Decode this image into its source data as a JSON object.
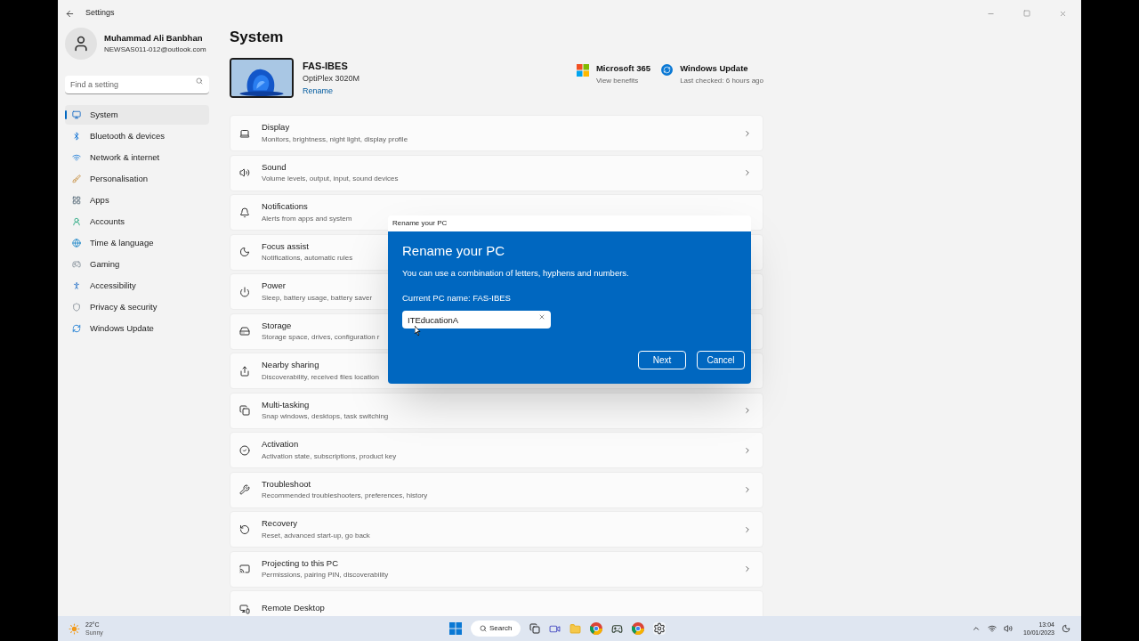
{
  "window": {
    "title": "Settings"
  },
  "user": {
    "name": "Muhammad Ali Banbhan",
    "email": "NEWSAS011-012@outlook.com"
  },
  "search": {
    "placeholder": "Find a setting"
  },
  "sidebar": {
    "items": [
      {
        "label": "System",
        "selected": true
      },
      {
        "label": "Bluetooth & devices",
        "selected": false
      },
      {
        "label": "Network & internet",
        "selected": false
      },
      {
        "label": "Personalisation",
        "selected": false
      },
      {
        "label": "Apps",
        "selected": false
      },
      {
        "label": "Accounts",
        "selected": false
      },
      {
        "label": "Time & language",
        "selected": false
      },
      {
        "label": "Gaming",
        "selected": false
      },
      {
        "label": "Accessibility",
        "selected": false
      },
      {
        "label": "Privacy & security",
        "selected": false
      },
      {
        "label": "Windows Update",
        "selected": false
      }
    ]
  },
  "page_title": "System",
  "device": {
    "name": "FAS-IBES",
    "model": "OptiPlex 3020M",
    "rename_link": "Rename"
  },
  "quick_links": [
    {
      "title": "Microsoft 365",
      "subtitle": "View benefits"
    },
    {
      "title": "Windows Update",
      "subtitle": "Last checked: 6 hours ago"
    }
  ],
  "settings": [
    {
      "title": "Display",
      "subtitle": "Monitors, brightness, night light, display profile",
      "chevron": true
    },
    {
      "title": "Sound",
      "subtitle": "Volume levels, output, input, sound devices",
      "chevron": true
    },
    {
      "title": "Notifications",
      "subtitle": "Alerts from apps and system",
      "chevron": false
    },
    {
      "title": "Focus assist",
      "subtitle": "Notifications, automatic rules",
      "chevron": false
    },
    {
      "title": "Power",
      "subtitle": "Sleep, battery usage, battery saver",
      "chevron": false
    },
    {
      "title": "Storage",
      "subtitle": "Storage space, drives, configuration r",
      "chevron": false
    },
    {
      "title": "Nearby sharing",
      "subtitle": "Discoverability, received files location",
      "chevron": false
    },
    {
      "title": "Multi-tasking",
      "subtitle": "Snap windows, desktops, task switching",
      "chevron": true
    },
    {
      "title": "Activation",
      "subtitle": "Activation state, subscriptions, product key",
      "chevron": true
    },
    {
      "title": "Troubleshoot",
      "subtitle": "Recommended troubleshooters, preferences, history",
      "chevron": true
    },
    {
      "title": "Recovery",
      "subtitle": "Reset, advanced start-up, go back",
      "chevron": true
    },
    {
      "title": "Projecting to this PC",
      "subtitle": "Permissions, pairing PIN, discoverability",
      "chevron": true
    },
    {
      "title": "Remote Desktop",
      "chevron": false
    }
  ],
  "dialog": {
    "title": "Rename your PC",
    "heading": "Rename your PC",
    "message": "You can use a combination of letters, hyphens and numbers.",
    "current_label": "Current PC name: FAS-IBES",
    "value": "ITEducationA",
    "buttons": [
      "Next",
      "Cancel"
    ]
  },
  "taskbar": {
    "weather": {
      "temp": "22°C",
      "condition": "Sunny"
    },
    "search": "Search",
    "time": "13:04",
    "date": "10/01/2023"
  }
}
